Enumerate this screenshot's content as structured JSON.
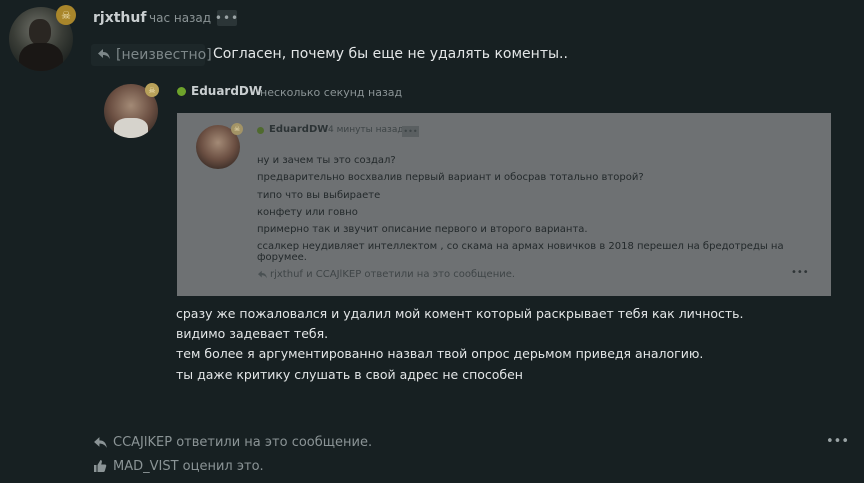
{
  "post": {
    "author": "rjxthuf",
    "time": "час назад",
    "menu": "•••",
    "quote_ref": "[неизвестно]",
    "text": "Согласен, почему бы еще не удалять коменты.."
  },
  "reply": {
    "author": "EduardDW",
    "time": "несколько секунд назад",
    "quoted": {
      "author": "EduardDW",
      "time": "4 минуты назад",
      "menu": "•••",
      "lines": [
        "ну и зачем ты это создал?",
        "предварительно восхвалив первый вариант и обосрав тотально второй?",
        "типо что вы выбираете",
        "конфету или говно",
        "примерно так и звучит описание первого и второго варианта.",
        "ссалкер неудивляет интеллектом , со скама на армах новичков в 2018 перешел на бредотреды на форумее."
      ],
      "footer": "rjxthuf и CCAJlKEP ответили на это сообщение.",
      "footer_menu": "•••"
    },
    "lines": [
      "сразу же пожаловался и удалил мой комент который раскрывает тебя как личность.",
      "видимо задевает тебя.",
      "тем более я аргументированно назвал твой опрос дерьмом приведя аналогию.",
      "ты даже критику слушать в свой адрес не способен"
    ]
  },
  "footer": {
    "replied": "CCAJlKEP ответили на это сообщение.",
    "liked": "MAD_VIST оценил это.",
    "menu": "•••"
  },
  "colors": {
    "background": "#172022",
    "badge": "#a9862b",
    "online": "#6ea32b",
    "embed": "#6e7173"
  },
  "icons": {
    "reply": "reply-arrow-icon",
    "like": "thumbs-up-icon",
    "badge": "skull-badge-icon"
  }
}
